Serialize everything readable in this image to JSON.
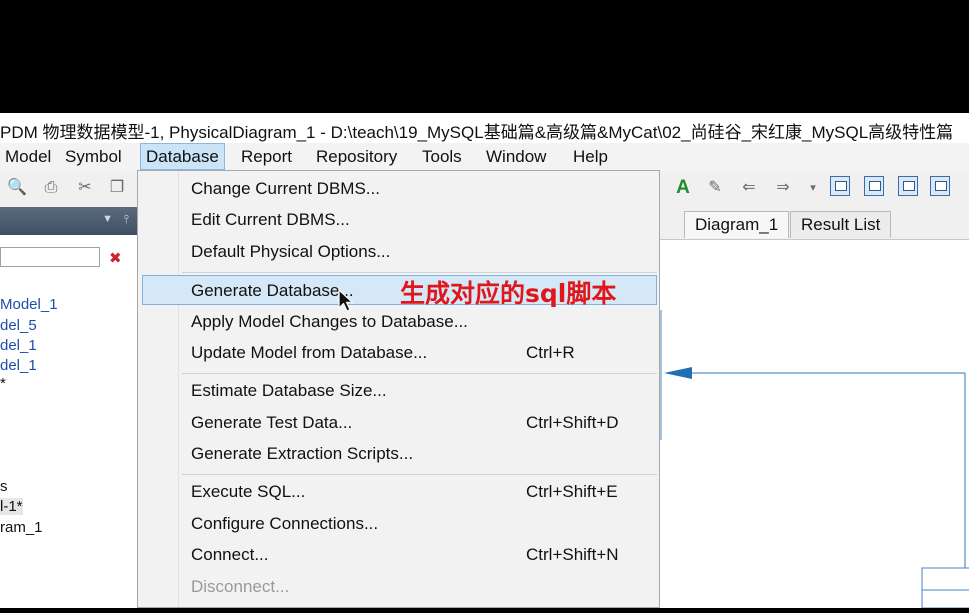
{
  "window": {
    "title": "PDM 物理数据模型-1, PhysicalDiagram_1 - D:\\teach\\19_MySQL基础篇&高级篇&MyCat\\02_尚硅谷_宋红康_MySQL高级特性篇"
  },
  "menubar": {
    "items": [
      "Model",
      "Symbol",
      "Database",
      "Report",
      "Repository",
      "Tools",
      "Window",
      "Help"
    ]
  },
  "left_panel": {
    "tree": [
      {
        "label": "Model_1",
        "color": "#1d4fa8"
      },
      {
        "label": "del_5",
        "color": "#1d4fa8"
      },
      {
        "label": "del_1",
        "color": "#1d4fa8"
      },
      {
        "label": "del_1",
        "color": "#1d4fa8"
      },
      {
        "label": "*",
        "color": "#111111"
      },
      {
        "label": "s",
        "color": "#111111"
      },
      {
        "label": "l-1*",
        "color": "#111111"
      },
      {
        "label": "ram_1",
        "color": "#111111"
      }
    ]
  },
  "tabs": [
    "Diagram_1",
    "Result List"
  ],
  "database_menu": {
    "items": [
      {
        "label": "Change Current DBMS...",
        "shortcut": ""
      },
      {
        "label": "Edit Current DBMS...",
        "shortcut": ""
      },
      {
        "label": "Default Physical Options...",
        "shortcut": ""
      },
      {
        "label": "Generate Database...",
        "shortcut": "",
        "highlighted": true
      },
      {
        "label": "Apply Model Changes to Database...",
        "shortcut": ""
      },
      {
        "label": "Update Model from Database...",
        "shortcut": "Ctrl+R"
      },
      {
        "label": "Estimate Database Size...",
        "shortcut": ""
      },
      {
        "label": "Generate Test Data...",
        "shortcut": "Ctrl+Shift+D"
      },
      {
        "label": "Generate Extraction Scripts...",
        "shortcut": ""
      },
      {
        "label": "Execute SQL...",
        "shortcut": "Ctrl+Shift+E"
      },
      {
        "label": "Configure Connections...",
        "shortcut": ""
      },
      {
        "label": "Connect...",
        "shortcut": "Ctrl+Shift+N"
      },
      {
        "label": "Disconnect...",
        "shortcut": "",
        "disabled": true
      }
    ]
  },
  "annotation": {
    "text": "生成对应的sql脚本",
    "color": "#e0161b"
  },
  "colors": {
    "accent": "#2a7ab8",
    "menu_highlight": "#d5e8f8"
  }
}
